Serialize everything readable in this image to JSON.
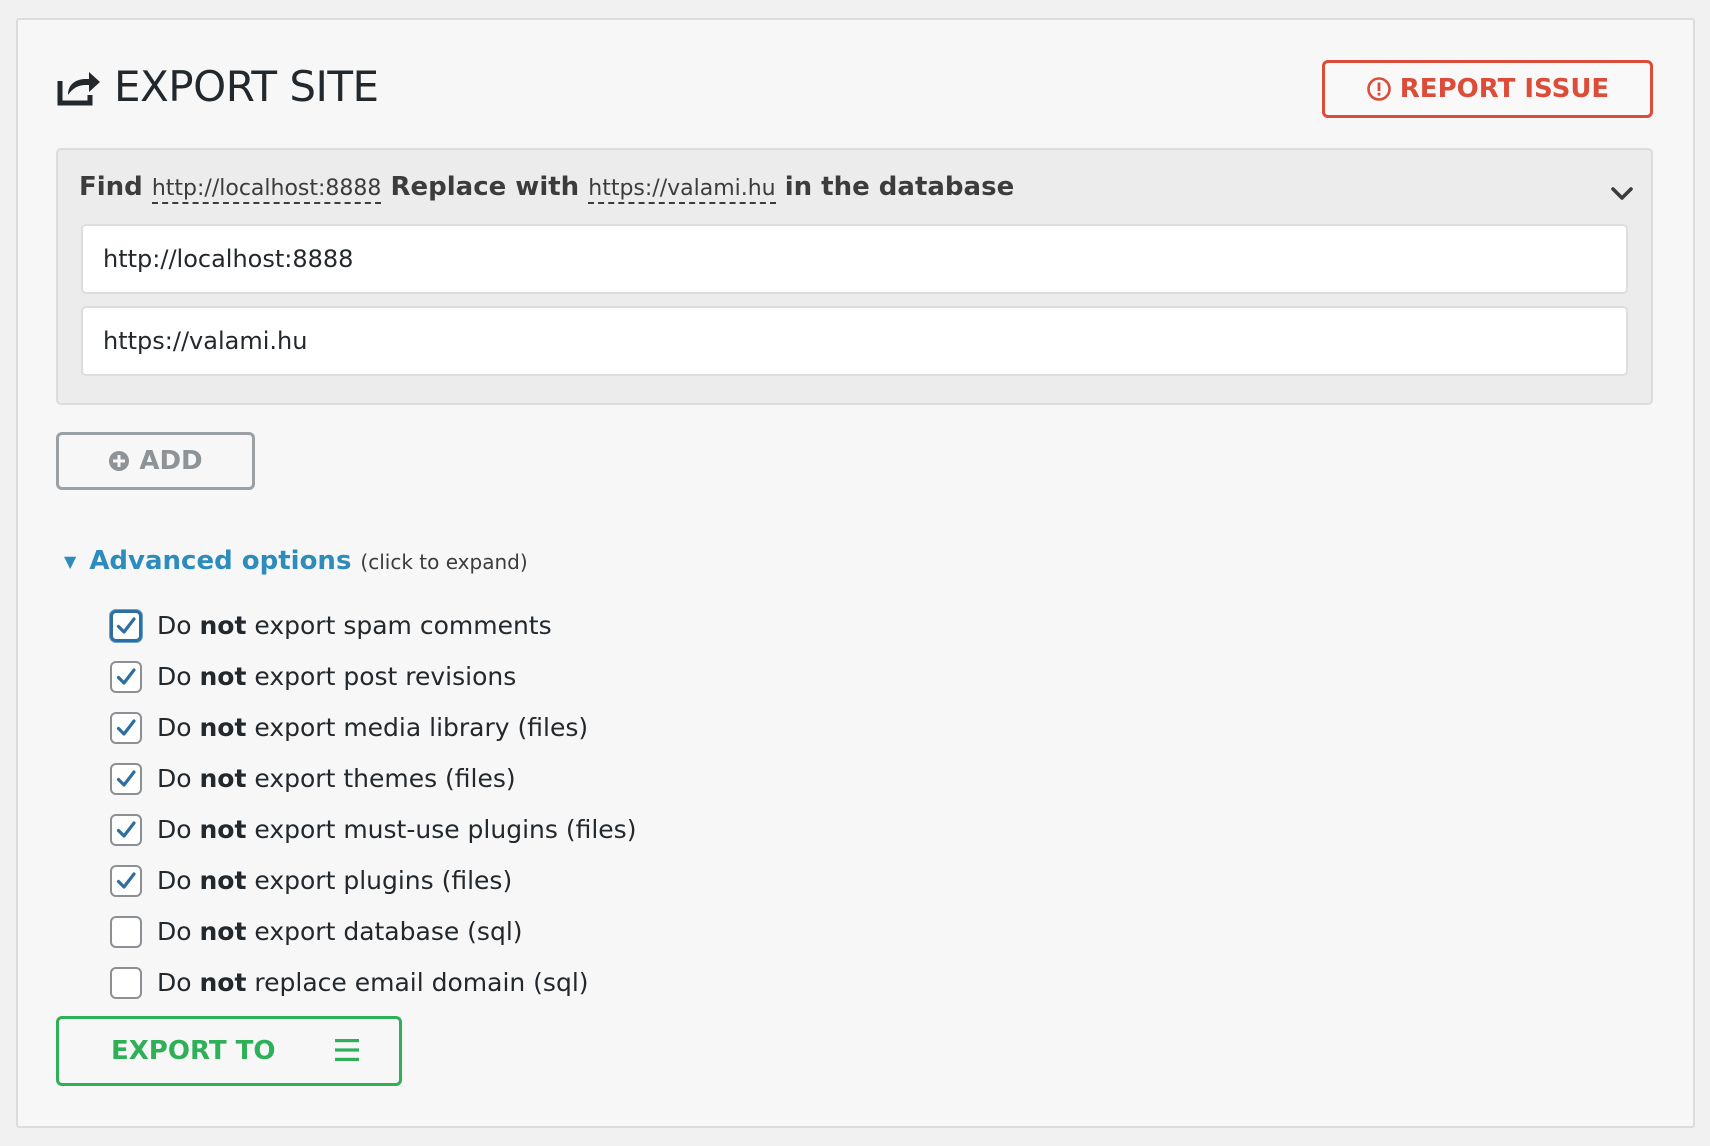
{
  "header": {
    "title": "EXPORT SITE",
    "icon": "share-icon",
    "report_label": "REPORT ISSUE"
  },
  "replace": {
    "find_word": "Find",
    "find_url": "http://localhost:8888",
    "replace_word": "Replace with",
    "replace_url": "https://valami.hu",
    "suffix": "in the database",
    "find_value": "http://localhost:8888",
    "replace_value": "https://valami.hu"
  },
  "add_label": "ADD",
  "advanced": {
    "title": "Advanced options",
    "hint": "(click to expand)"
  },
  "options": [
    {
      "pre": "Do",
      "bold": "not",
      "post": "export spam comments",
      "checked": true
    },
    {
      "pre": "Do",
      "bold": "not",
      "post": "export post revisions",
      "checked": true
    },
    {
      "pre": "Do",
      "bold": "not",
      "post": "export media library (files)",
      "checked": true
    },
    {
      "pre": "Do",
      "bold": "not",
      "post": "export themes (files)",
      "checked": true
    },
    {
      "pre": "Do",
      "bold": "not",
      "post": "export must-use plugins (files)",
      "checked": true
    },
    {
      "pre": "Do",
      "bold": "not",
      "post": "export plugins (files)",
      "checked": true
    },
    {
      "pre": "Do",
      "bold": "not",
      "post": "export database (sql)",
      "checked": false
    },
    {
      "pre": "Do",
      "bold": "not",
      "post": "replace email domain (sql)",
      "checked": false
    }
  ],
  "export_label": "EXPORT TO",
  "colors": {
    "report": "#dd4b39",
    "link": "#2e8cbd",
    "export": "#2eb058",
    "check": "#2e6ea0"
  }
}
